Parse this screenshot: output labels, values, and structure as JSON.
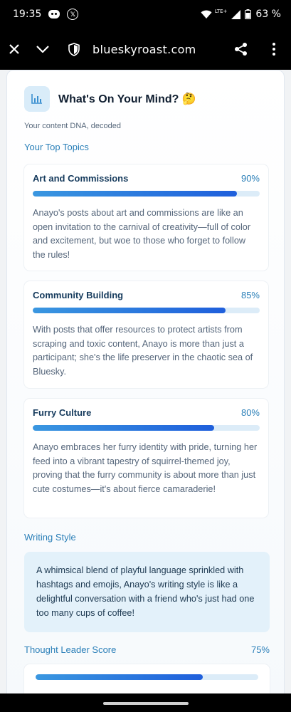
{
  "status_bar": {
    "time": "19:35",
    "battery": "63 %",
    "lte": "LTE+"
  },
  "browser": {
    "url": "blueskyroast.com"
  },
  "card": {
    "title": "What's On Your Mind? 🤔",
    "subtitle": "Your content DNA, decoded",
    "topics_label": "Your Top Topics",
    "topics": [
      {
        "name": "Art and Commissions",
        "percent_label": "90%",
        "percent": 0.9,
        "description": "Anayo's posts about art and commissions are like an open invitation to the carnival of creativity—full of color and excitement, but woe to those who forget to follow the rules!"
      },
      {
        "name": "Community Building",
        "percent_label": "85%",
        "percent": 0.85,
        "description": "With posts that offer resources to protect artists from scraping and toxic content, Anayo is more than just a participant; she's the life preserver in the chaotic sea of Bluesky."
      },
      {
        "name": "Furry Culture",
        "percent_label": "80%",
        "percent": 0.8,
        "description": "Anayo embraces her furry identity with pride, turning her feed into a vibrant tapestry of squirrel-themed joy, proving that the furry community is about more than just cute costumes—it's about fierce camaraderie!"
      }
    ],
    "writing_style_label": "Writing Style",
    "writing_style_text": "A whimsical blend of playful language sprinkled with hashtags and emojis, Anayo's writing style is like a delightful conversation with a friend who's just had one too many cups of coffee!",
    "thought_leader_label": "Thought Leader Score",
    "thought_leader_percent_label": "75%",
    "thought_leader_percent": 0.75
  },
  "colors": {
    "accent": "#2a7fb8",
    "bar_start": "#3a97e0",
    "bar_end": "#1f5fdc",
    "track": "#dcecf8"
  }
}
